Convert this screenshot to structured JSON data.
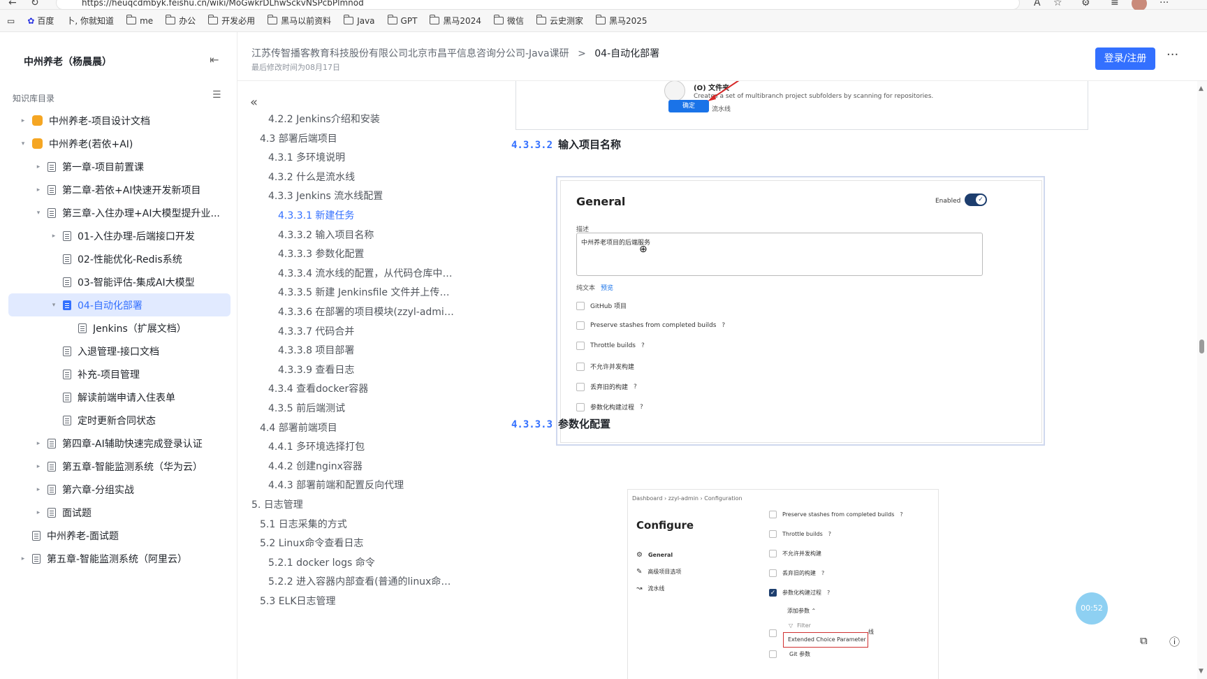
{
  "browser": {
    "url": "https://heuqcdmbyk.feishu.cn/wiki/MoGwkrDLhwSckvNSPcbPlmnod",
    "bookmarks": [
      "百度",
      "卜, 你就知道",
      "me",
      "办公",
      "开发必用",
      "黑马以前资料",
      "Java",
      "GPT",
      "黑马2024",
      "微信",
      "云史测家",
      "黑马2025"
    ]
  },
  "sidebar": {
    "space_title": "中州养老（杨晨晨）",
    "kb_label": "知识库目录",
    "items": [
      {
        "label": "中州养老-项目设计文档",
        "indent": 0,
        "caret": "▸",
        "icon": "space-orange"
      },
      {
        "label": "中州养老(若依+AI)",
        "indent": 0,
        "caret": "▾",
        "icon": "space-orange"
      },
      {
        "label": "第一章-项目前置课",
        "indent": 1,
        "caret": "▸",
        "icon": "doc"
      },
      {
        "label": "第二章-若依+AI快速开发新项目",
        "indent": 1,
        "caret": "▸",
        "icon": "doc"
      },
      {
        "label": "第三章-入住办理+AI大模型提升业...",
        "indent": 1,
        "caret": "▾",
        "icon": "doc"
      },
      {
        "label": "01-入住办理-后端接口开发",
        "indent": 2,
        "caret": "▸",
        "icon": "doc"
      },
      {
        "label": "02-性能优化-Redis系统",
        "indent": 2,
        "caret": "",
        "icon": "doc"
      },
      {
        "label": "03-智能评估-集成AI大模型",
        "indent": 2,
        "caret": "",
        "icon": "doc"
      },
      {
        "label": "04-自动化部署",
        "indent": 2,
        "caret": "▾",
        "icon": "doc",
        "active": true
      },
      {
        "label": "Jenkins（扩展文档）",
        "indent": 3,
        "caret": "",
        "icon": "doc"
      },
      {
        "label": "入退管理-接口文档",
        "indent": 2,
        "caret": "",
        "icon": "doc"
      },
      {
        "label": "补充-项目管理",
        "indent": 2,
        "caret": "",
        "icon": "doc"
      },
      {
        "label": "解读前端申请入住表单",
        "indent": 2,
        "caret": "",
        "icon": "doc"
      },
      {
        "label": "定时更新合同状态",
        "indent": 2,
        "caret": "",
        "icon": "doc"
      },
      {
        "label": "第四章-AI辅助快速完成登录认证",
        "indent": 1,
        "caret": "▸",
        "icon": "doc"
      },
      {
        "label": "第五章-智能监测系统（华为云）",
        "indent": 1,
        "caret": "▸",
        "icon": "doc"
      },
      {
        "label": "第六章-分组实战",
        "indent": 1,
        "caret": "▸",
        "icon": "doc"
      },
      {
        "label": "面试题",
        "indent": 1,
        "caret": "▸",
        "icon": "doc"
      },
      {
        "label": "中州养老-面试题",
        "indent": 0,
        "caret": "",
        "icon": "doc"
      },
      {
        "label": "第五章-智能监测系统（阿里云）",
        "indent": 0,
        "caret": "▸",
        "icon": "doc"
      }
    ]
  },
  "header": {
    "breadcrumb_parent": "江苏传智播客教育科技股份有限公司北京市昌平信息咨询分公司-Java课研",
    "breadcrumb_sep": ">",
    "breadcrumb_current": "04-自动化部署",
    "edit_time": "最后修改时间为08月17日",
    "login_label": "登录/注册",
    "more_label": "···"
  },
  "outline": {
    "collapse_glyph": "«",
    "items": [
      {
        "label": "4.2.2 Jenkins介绍和安装",
        "level": 2
      },
      {
        "label": "4.3 部署后端项目",
        "level": 1
      },
      {
        "label": "4.3.1 多环境说明",
        "level": 2
      },
      {
        "label": "4.3.2 什么是流水线",
        "level": 2
      },
      {
        "label": "4.3.3 Jenkins 流水线配置",
        "level": 2
      },
      {
        "label": "4.3.3.1 新建任务",
        "level": 3,
        "current": true
      },
      {
        "label": "4.3.3.2 输入项目名称",
        "level": 3
      },
      {
        "label": "4.3.3.3 参数化配置",
        "level": 3
      },
      {
        "label": "4.3.3.4 流水线的配置，从代码仓库中读...",
        "level": 3
      },
      {
        "label": "4.3.3.5 新建 Jenkinsfile 文件并上传到...",
        "level": 3
      },
      {
        "label": "4.3.3.6 在部署的项目模块(zzyl-admin)...",
        "level": 3
      },
      {
        "label": "4.3.3.7 代码合并",
        "level": 3
      },
      {
        "label": "4.3.3.8 项目部署",
        "level": 3
      },
      {
        "label": "4.3.3.9 查看日志",
        "level": 3
      },
      {
        "label": "4.3.4 查看docker容器",
        "level": 2
      },
      {
        "label": "4.3.5 前后端测试",
        "level": 2
      },
      {
        "label": "4.4 部署前端项目",
        "level": 1
      },
      {
        "label": "4.4.1 多环境选择打包",
        "level": 2
      },
      {
        "label": "4.4.2 创建nginx容器",
        "level": 2
      },
      {
        "label": "4.4.3 部署前端和配置反向代理",
        "level": 2
      },
      {
        "label": "5. 日志管理",
        "level": 0
      },
      {
        "label": "5.1 日志采集的方式",
        "level": 1
      },
      {
        "label": "5.2 Linux命令查看日志",
        "level": 1
      },
      {
        "label": "5.2.1 docker logs 命令",
        "level": 2
      },
      {
        "label": "5.2.2 进入容器内部查看(普通的linux命令...",
        "level": 2
      },
      {
        "label": "5.3 ELK日志管理",
        "level": 1
      }
    ]
  },
  "doc": {
    "top_image": {
      "folder_label": "(O) 文件夹",
      "folder_desc": "Creates a set of multibranch project subfolders by scanning for repositories.",
      "ok_label": "确定",
      "pipeline_label": "流水线"
    },
    "heading_2": {
      "num": "4.3.3.2",
      "text": "输入项目名称"
    },
    "general": {
      "title": "General",
      "enabled_label": "Enabled",
      "desc_label": "描述",
      "desc_value": "中州养老项目的后端服务",
      "plain_text_label": "纯文本",
      "preview_label": "预览",
      "checkboxes": [
        {
          "label": "GitHub 项目",
          "help": ""
        },
        {
          "label": "Preserve stashes from completed builds",
          "help": "?"
        },
        {
          "label": "Throttle builds",
          "help": "?"
        },
        {
          "label": "不允许并发构建",
          "help": ""
        },
        {
          "label": "丢弃旧的构建",
          "help": "?"
        },
        {
          "label": "参数化构建过程",
          "help": "?"
        }
      ]
    },
    "heading_3": {
      "num": "4.3.3.3",
      "text": "参数化配置"
    },
    "configure": {
      "crumb": "Dashboard  ›  zzyl-admin  ›  Configuration",
      "title": "Configure",
      "nav": [
        "General",
        "高级项目选项",
        "流水线"
      ],
      "rows": [
        {
          "label": "Preserve stashes from completed builds",
          "help": "?",
          "checked": false
        },
        {
          "label": "Throttle builds",
          "help": "?",
          "checked": false
        },
        {
          "label": "不允许并发构建",
          "help": "",
          "checked": false
        },
        {
          "label": "丢弃旧的构建",
          "help": "?",
          "checked": false
        },
        {
          "label": "参数化构建过程",
          "help": "?",
          "checked": true
        }
      ],
      "add_param": "添加参数 ⌃",
      "filter": "Filter",
      "ext_choice": "Extended Choice Parameter",
      "git_param": "Git 参数",
      "side_text": "线"
    }
  },
  "floating": {
    "timer": "00:52"
  }
}
